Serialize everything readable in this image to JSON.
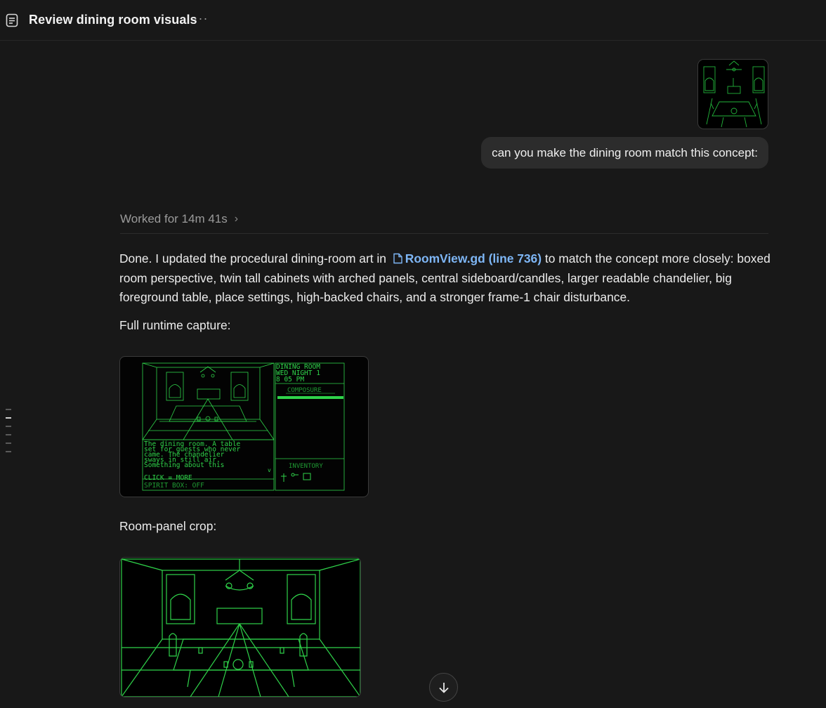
{
  "header": {
    "title": "Review dining room visuals",
    "more_icon": "ellipsis-icon",
    "doc_icon": "document-icon"
  },
  "user_message": {
    "text": "can you make the dining room match this concept:",
    "attachment_icon": "image-thumbnail"
  },
  "assistant": {
    "worked_for": "Worked for 14m 41s",
    "intro": "Done. I updated the procedural dining-room art in",
    "file_link": "RoomView.gd (line 736)",
    "summary": "to match the concept more closely: boxed room perspective, twin tall cabinets with arched panels, central sideboard/candles, larger readable chandelier, big foreground table, place settings, high-backed chairs, and a stronger frame-1 chair disturbance.",
    "capture_label": "Full runtime capture:",
    "crop_label": "Room-panel crop:"
  },
  "game_screen": {
    "location": "DINING ROOM",
    "day": "WED NIGHT 1",
    "time": "8 05 PM",
    "meter_label": "COMPOSURE",
    "composure_level": 1.0,
    "narration": [
      "The dining room. A table",
      "set for guests who never",
      "came. The chandelier",
      "sways in still air.",
      "Something about this"
    ],
    "more_arrow": "v",
    "click_hint": "CLICK = MORE",
    "spirit_box": "SPIRIT BOX: OFF",
    "inventory_label": "INVENTORY"
  },
  "colors": {
    "accent_link": "#7eb6f5",
    "crt_green": "#2fd34a"
  },
  "minimap": {
    "tick_count": 6,
    "active_index": 1
  }
}
